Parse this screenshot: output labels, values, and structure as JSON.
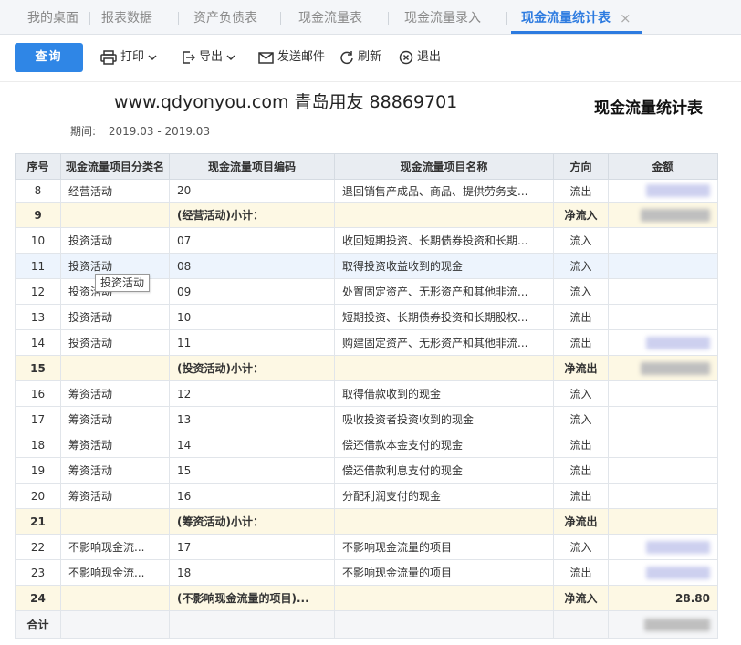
{
  "tabs": [
    {
      "label": "我的桌面",
      "active": false
    },
    {
      "label": "报表数据",
      "active": false
    },
    {
      "label": "资产负债表",
      "active": false
    },
    {
      "label": "现金流量表",
      "active": false
    },
    {
      "label": "现金流量录入",
      "active": false
    },
    {
      "label": "现金流量统计表",
      "active": true
    }
  ],
  "tab_close_glyph": "×",
  "toolbar": {
    "query_label": "查询",
    "print_label": "打印",
    "export_label": "导出",
    "email_label": "发送邮件",
    "refresh_label": "刷新",
    "exit_label": "退出"
  },
  "header": {
    "site_text": "www.qdyonyou.com  青岛用友 88869701",
    "report_title": "现金流量统计表",
    "period_label": "期间:",
    "period_value": "2019.03 - 2019.03"
  },
  "table": {
    "columns": [
      "序号",
      "现金流量项目分类名",
      "现金流量项目编码",
      "现金流量项目名称",
      "方向",
      "金额"
    ],
    "rows": [
      {
        "no": "8",
        "category": "经营活动",
        "code": "20",
        "name": "退回销售产成品、商品、提供劳务支...",
        "direction": "流出",
        "amount": "",
        "type": "normal",
        "blur": "purple"
      },
      {
        "no": "9",
        "category": "",
        "code": "(经营活动)小计：",
        "name": "",
        "direction": "净流入",
        "amount": "",
        "type": "subtotal",
        "blur": "gray"
      },
      {
        "no": "10",
        "category": "投资活动",
        "code": "07",
        "name": "收回短期投资、长期债券投资和长期...",
        "direction": "流入",
        "amount": "",
        "type": "normal",
        "blur": ""
      },
      {
        "no": "11",
        "category": "投资活动",
        "code": "08",
        "name": "取得投资收益收到的现金",
        "direction": "流入",
        "amount": "",
        "type": "hover",
        "blur": ""
      },
      {
        "no": "12",
        "category": "投资活动",
        "code": "09",
        "name": "处置固定资产、无形资产和其他非流...",
        "direction": "流入",
        "amount": "",
        "type": "normal",
        "blur": ""
      },
      {
        "no": "13",
        "category": "投资活动",
        "code": "10",
        "name": "短期投资、长期债券投资和长期股权...",
        "direction": "流出",
        "amount": "",
        "type": "normal",
        "blur": ""
      },
      {
        "no": "14",
        "category": "投资活动",
        "code": "11",
        "name": "购建固定资产、无形资产和其他非流...",
        "direction": "流出",
        "amount": "",
        "type": "normal",
        "blur": "purple"
      },
      {
        "no": "15",
        "category": "",
        "code": "(投资活动)小计：",
        "name": "",
        "direction": "净流出",
        "amount": "",
        "type": "subtotal",
        "blur": "gray"
      },
      {
        "no": "16",
        "category": "筹资活动",
        "code": "12",
        "name": "取得借款收到的现金",
        "direction": "流入",
        "amount": "",
        "type": "normal",
        "blur": ""
      },
      {
        "no": "17",
        "category": "筹资活动",
        "code": "13",
        "name": "吸收投资者投资收到的现金",
        "direction": "流入",
        "amount": "",
        "type": "normal",
        "blur": ""
      },
      {
        "no": "18",
        "category": "筹资活动",
        "code": "14",
        "name": "偿还借款本金支付的现金",
        "direction": "流出",
        "amount": "",
        "type": "normal",
        "blur": ""
      },
      {
        "no": "19",
        "category": "筹资活动",
        "code": "15",
        "name": "偿还借款利息支付的现金",
        "direction": "流出",
        "amount": "",
        "type": "normal",
        "blur": ""
      },
      {
        "no": "20",
        "category": "筹资活动",
        "code": "16",
        "name": "分配利润支付的现金",
        "direction": "流出",
        "amount": "",
        "type": "normal",
        "blur": ""
      },
      {
        "no": "21",
        "category": "",
        "code": "(筹资活动)小计：",
        "name": "",
        "direction": "净流出",
        "amount": "",
        "type": "subtotal",
        "blur": ""
      },
      {
        "no": "22",
        "category": "不影响现金流...",
        "code": "17",
        "name": "不影响现金流量的项目",
        "direction": "流入",
        "amount": "",
        "type": "normal",
        "blur": "purple"
      },
      {
        "no": "23",
        "category": "不影响现金流...",
        "code": "18",
        "name": "不影响现金流量的项目",
        "direction": "流出",
        "amount": "",
        "type": "normal",
        "blur": "purple"
      },
      {
        "no": "24",
        "category": "",
        "code": "(不影响现金流量的项目)...",
        "name": "",
        "direction": "净流入",
        "amount": "28.80",
        "type": "subtotal",
        "blur": ""
      }
    ],
    "total_label": "合计"
  },
  "tooltip_text": "投资活动",
  "colors": {
    "accent": "#2d7be0",
    "query_button": "#2f86e6",
    "subtotal_row": "#fdf8e4",
    "header_bg": "#e9edf2"
  }
}
